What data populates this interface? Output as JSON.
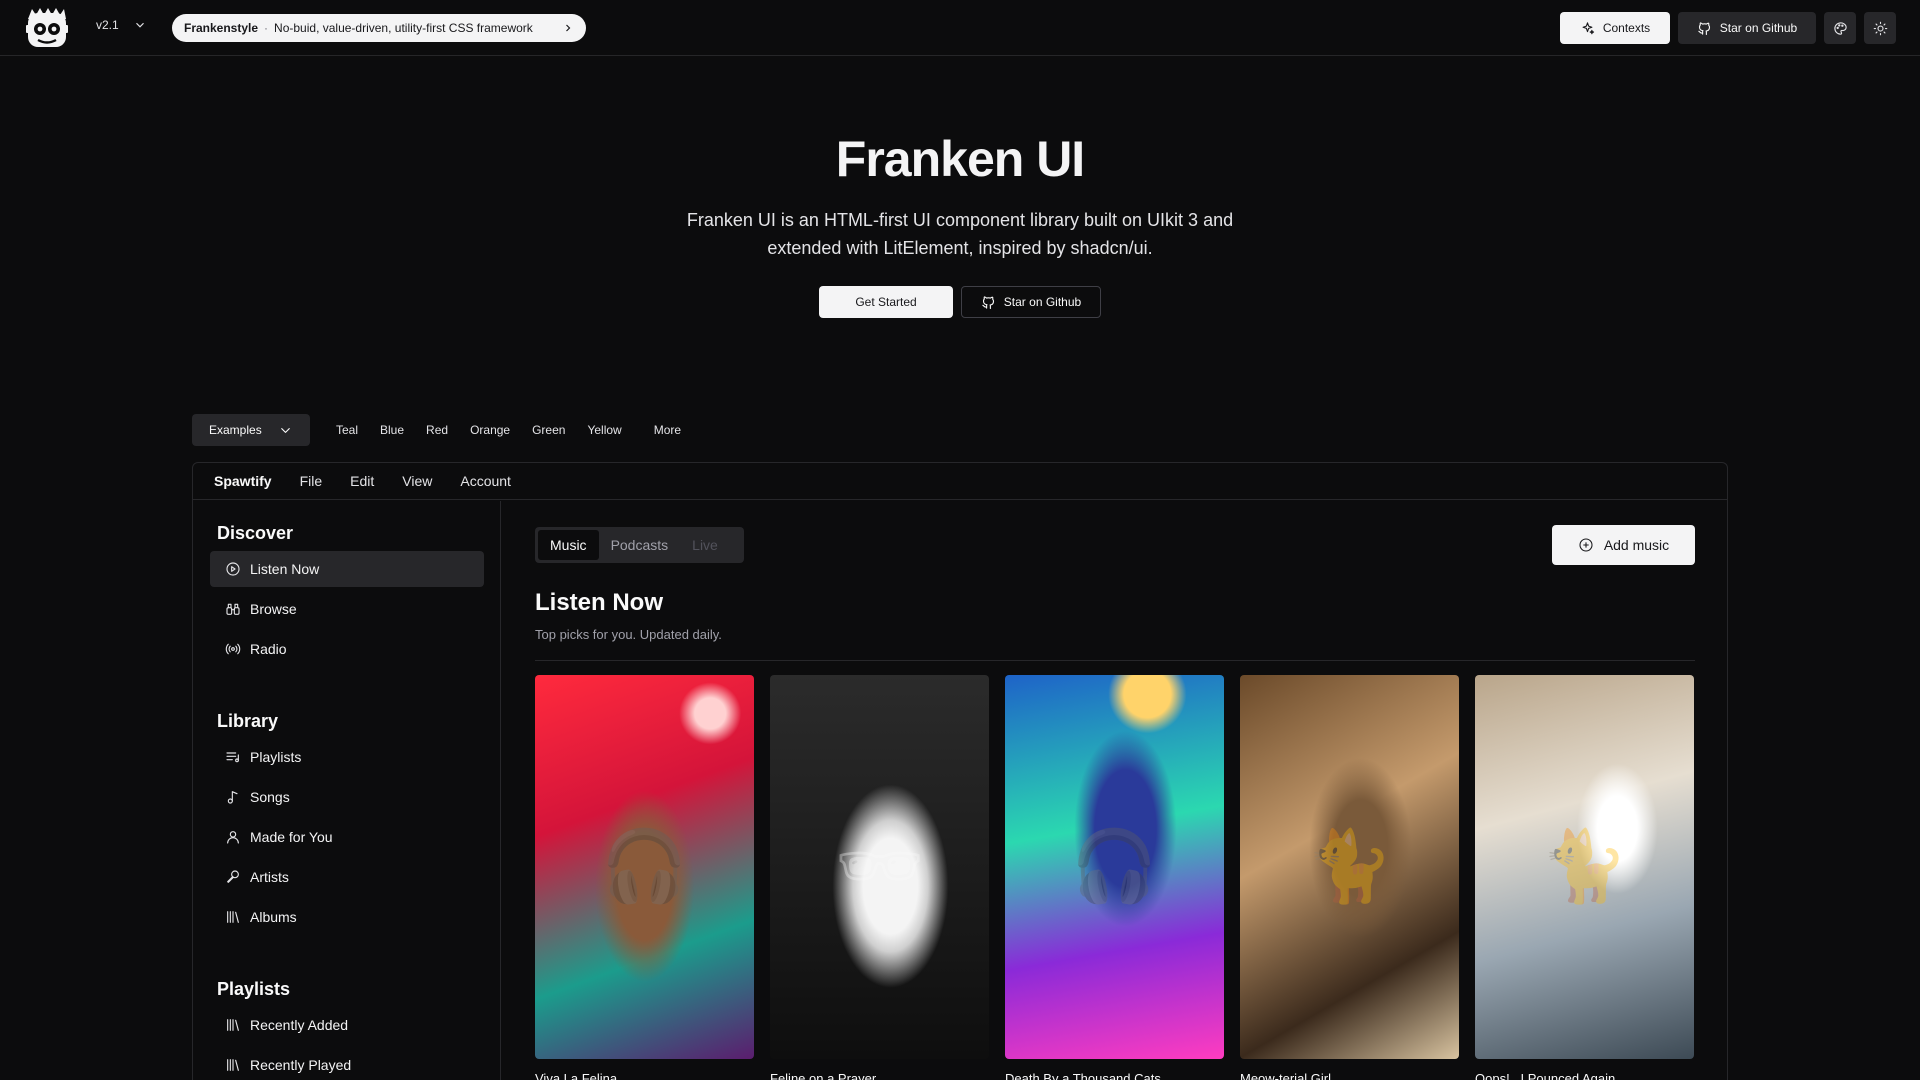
{
  "header": {
    "version": "v2.1",
    "announcement": {
      "brand": "Frankenstyle",
      "separator": "·",
      "text": "No-buid, value-driven, utility-first CSS framework"
    },
    "contexts_label": "Contexts",
    "star_label": "Star on Github"
  },
  "hero": {
    "title": "Franken UI",
    "description": "Franken UI is an HTML-first UI component library built on UIkit 3 and extended with LitElement, inspired by shadcn/ui.",
    "get_started": "Get Started",
    "star": "Star on Github"
  },
  "themes": {
    "examples_label": "Examples",
    "items": [
      "Teal",
      "Blue",
      "Red",
      "Orange",
      "Green",
      "Yellow"
    ],
    "more": "More"
  },
  "app": {
    "menubar": [
      "Spawtify",
      "File",
      "Edit",
      "View",
      "Account"
    ],
    "sidebar": {
      "discover": {
        "heading": "Discover",
        "items": [
          {
            "label": "Listen Now",
            "icon": "play-circle-icon"
          },
          {
            "label": "Browse",
            "icon": "binoculars-icon"
          },
          {
            "label": "Radio",
            "icon": "radio-icon"
          }
        ]
      },
      "library": {
        "heading": "Library",
        "items": [
          {
            "label": "Playlists",
            "icon": "playlist-icon"
          },
          {
            "label": "Songs",
            "icon": "music-note-icon"
          },
          {
            "label": "Made for You",
            "icon": "user-icon"
          },
          {
            "label": "Artists",
            "icon": "microphone-icon"
          },
          {
            "label": "Albums",
            "icon": "library-icon"
          }
        ]
      },
      "playlists": {
        "heading": "Playlists",
        "items": [
          {
            "label": "Recently Added",
            "icon": "library-icon"
          },
          {
            "label": "Recently Played",
            "icon": "library-icon"
          }
        ]
      }
    },
    "tabs": [
      "Music",
      "Podcasts",
      "Live"
    ],
    "add_music": "Add music",
    "listen_now": {
      "title": "Listen Now",
      "subtitle": "Top picks for you. Updated daily."
    },
    "albums": [
      "Viva La Felina",
      "Feline on a Prayer",
      "Death By a Thousand Cats",
      "Meow-terial Girl",
      "Oops!.. I Pounced Again"
    ]
  }
}
